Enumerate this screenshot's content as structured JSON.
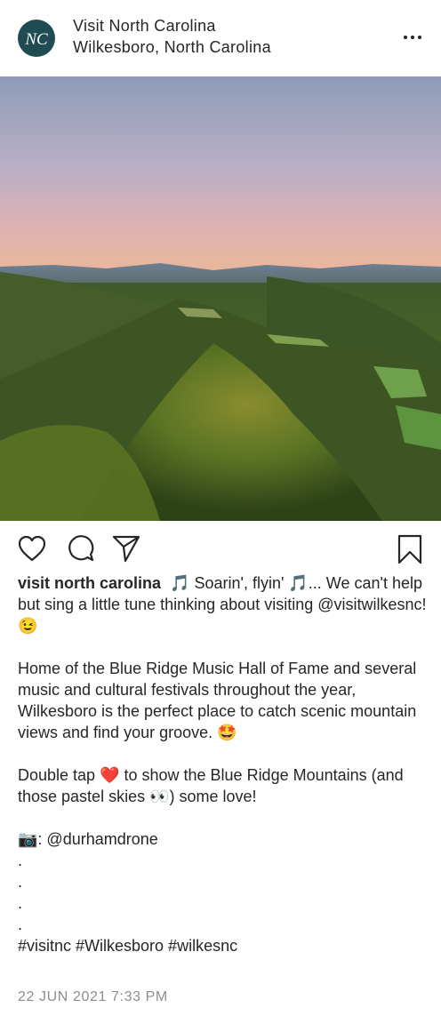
{
  "header": {
    "account_name": "Visit North Carolina",
    "location": "Wilkesboro, North Carolina",
    "avatar_text": "NC"
  },
  "photo": {
    "icon": "landscape-photo"
  },
  "actions": {
    "like_icon": "heart-icon",
    "comment_icon": "comment-icon",
    "share_icon": "send-icon",
    "save_icon": "bookmark-icon"
  },
  "caption": {
    "username": "visit north carolina",
    "line1": "🎵 Soarin', flyin' 🎵... We can't help but sing a little tune thinking about visiting ",
    "mention1": "@visitwilkesnc!",
    "line1_end": " 😉",
    "paragraph2": "Home of the Blue Ridge Music Hall of Fame and several music and cultural festivals throughout the year, Wilkesboro is the perfect place to catch scenic mountain views and find your groove. 🤩",
    "paragraph3": "Double tap ❤️ to show the Blue Ridge Mountains (and those pastel skies 👀) some love!",
    "credit_prefix": "📷: ",
    "credit_handle": "@durhamdrone",
    "dots": [
      ".",
      ".",
      ".",
      "."
    ],
    "hashtags": "#visitnc #Wilkesboro #wilkesnc"
  },
  "timestamp": "22 JUN 2021 7:33 PM"
}
